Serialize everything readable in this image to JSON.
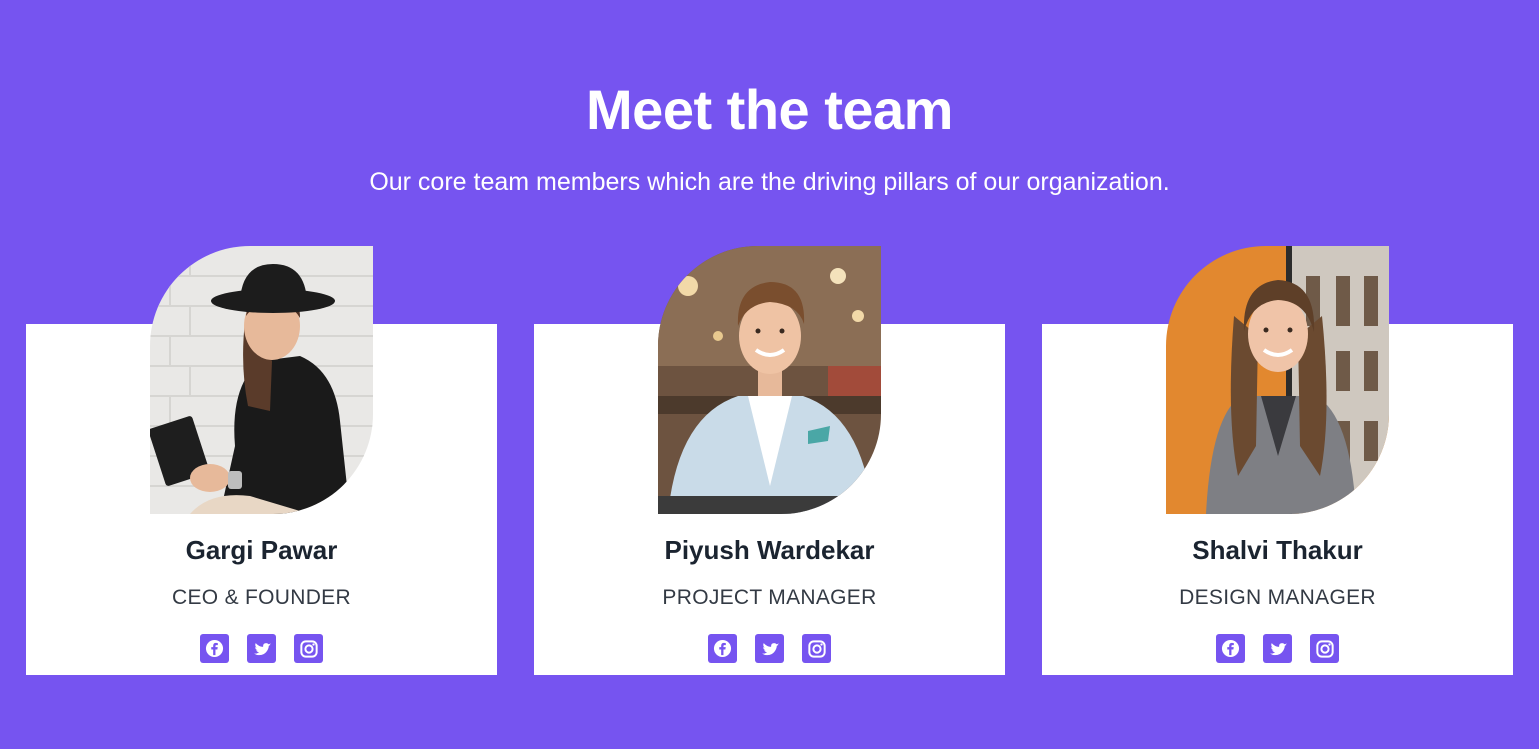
{
  "section": {
    "title": "Meet the team",
    "subtitle": "Our core team members which are the driving pillars of our organization."
  },
  "colors": {
    "background": "#7654f0",
    "card": "#ffffff",
    "accent": "#7654f0"
  },
  "team": [
    {
      "name": "Gargi Pawar",
      "role": "CEO & FOUNDER",
      "socials": [
        "facebook-icon",
        "twitter-icon",
        "instagram-icon"
      ]
    },
    {
      "name": "Piyush Wardekar",
      "role": "PROJECT MANAGER",
      "socials": [
        "facebook-icon",
        "twitter-icon",
        "instagram-icon"
      ]
    },
    {
      "name": "Shalvi Thakur",
      "role": "DESIGN MANAGER",
      "socials": [
        "facebook-icon",
        "twitter-icon",
        "instagram-icon"
      ]
    }
  ]
}
